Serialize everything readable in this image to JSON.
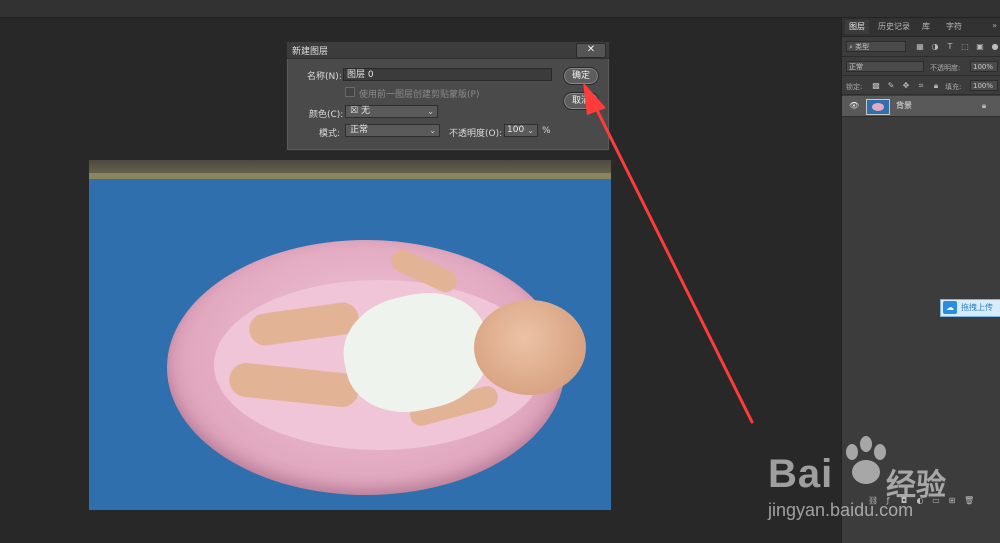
{
  "dialog": {
    "title": "新建图层",
    "close_label": "✕",
    "name_label": "名称(N):",
    "name_value": "图层 0",
    "clip_label": "使用前一图层创建剪贴蒙版(P)",
    "color_label": "颜色(C):",
    "color_value": "无",
    "color_swatch": "☒",
    "mode_label": "模式:",
    "mode_value": "正常",
    "opacity_label": "不透明度(O):",
    "opacity_value": "100",
    "opacity_unit": "%",
    "ok_label": "确定",
    "cancel_label": "取消"
  },
  "panel": {
    "tabs": [
      "图层",
      "历史记录",
      "库",
      "字符"
    ],
    "kind_label": "类型",
    "blend_mode": "正常",
    "opacity_label": "不透明度:",
    "opacity_value": "100%",
    "lock_label": "锁定:",
    "fill_label": "填充:",
    "fill_value": "100%",
    "layer_name": "背景"
  },
  "upload": {
    "label": "拖拽上传"
  },
  "watermark": {
    "brand": "Bai",
    "brand_cn": "经验",
    "url": "jingyan.baidu.com"
  },
  "colors": {
    "arrow": "#ff3b3b",
    "canvas_bg": "#2f6fad",
    "app_bg": "#282828"
  }
}
